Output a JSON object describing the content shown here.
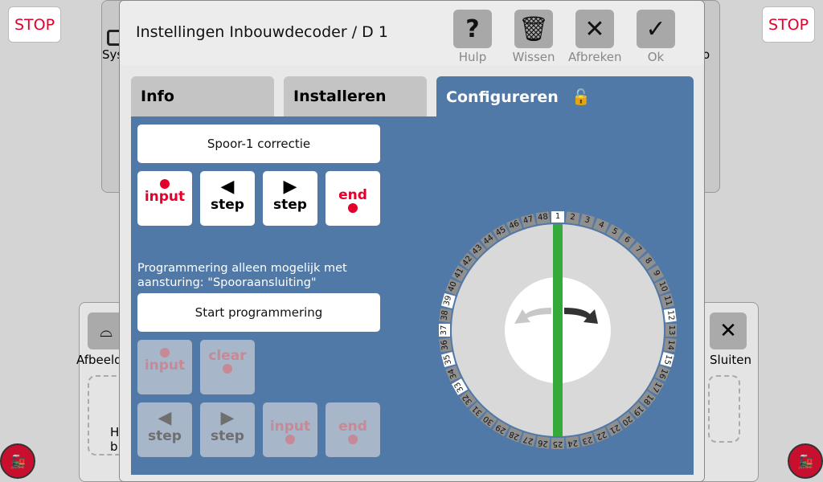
{
  "background": {
    "stop_label": "STOP",
    "left_label": "Sys",
    "right_label": "o",
    "bottom_left_label": "Afbeeld",
    "close_label": "Sluiten",
    "partial_text_1": "H",
    "partial_text_2": "b"
  },
  "dialog": {
    "title": "Instellingen Inbouwdecoder / D 1",
    "toolbar": [
      {
        "icon": "question-icon",
        "label": "Hulp"
      },
      {
        "icon": "trash-icon",
        "label": "Wissen"
      },
      {
        "icon": "close-icon",
        "label": "Afbreken"
      },
      {
        "icon": "check-icon",
        "label": "Ok"
      }
    ],
    "tabs": [
      {
        "label": "Info"
      },
      {
        "label": "Installeren"
      },
      {
        "label": "Configureren",
        "active": true,
        "icon": "unlock-icon"
      }
    ],
    "config": {
      "track_correction": "Spoor-1 correctie",
      "row1": [
        {
          "label": "input",
          "icon": "dot"
        },
        {
          "label": "step",
          "icon": "arrow-left"
        },
        {
          "label": "step",
          "icon": "arrow-right"
        },
        {
          "label": "end",
          "icon": "dot"
        }
      ],
      "note": "Programmering alleen mogelijk met aansturing: \"Spooraansluiting\"",
      "start": "Start programmering",
      "row2": [
        {
          "label": "input"
        },
        {
          "label": "clear"
        }
      ],
      "row3": [
        {
          "label": "step"
        },
        {
          "label": "step"
        },
        {
          "label": "input"
        },
        {
          "label": "end"
        }
      ]
    },
    "turntable": {
      "positions": 48,
      "highlighted": [
        1,
        12,
        15,
        33,
        35,
        37,
        39
      ],
      "track_color": "#33aa3a",
      "accent": "#5079a7"
    }
  }
}
